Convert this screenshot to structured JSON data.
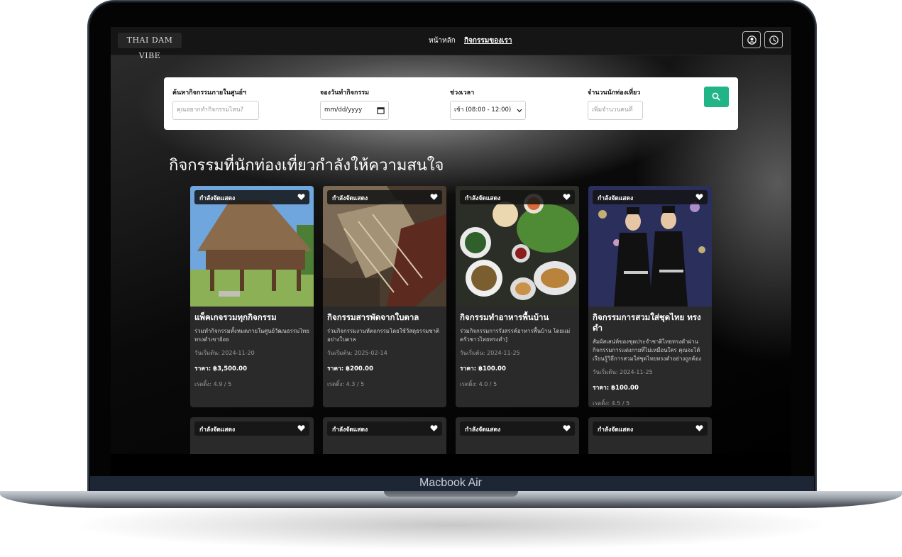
{
  "device": {
    "brand": "Macbook Air"
  },
  "nav": {
    "logo": "THAI DAM VIBE",
    "links": [
      "หน้าหลัก",
      "กิจกรรมของเรา"
    ],
    "active_link": "กิจกรรมของเรา",
    "icons": [
      "user-circle-icon",
      "clock-icon"
    ]
  },
  "search": {
    "activity_label": "ค้นหากิจกรรมภายในศูนย์ฯ",
    "activity_placeholder": "คุณอยากทำกิจกรรมไหน?",
    "date_label": "จองวันทำกิจกรรม",
    "date_value": "mm/dd/yyyy",
    "time_label": "ช่วงเวลา",
    "time_value": "เช้า (08:00 - 12:00)",
    "visitors_label": "จำนวนนักท่องเที่ยว",
    "visitors_placeholder": "เพิ่มจำนวนคนที่",
    "button_icon": "search-icon",
    "button_color": "#20b486"
  },
  "section": {
    "title": "กิจกรรมที่นักท่องเที่ยวกำลังให้ความสนใจ"
  },
  "cards": [
    {
      "badge": "กำลังจัดแสดง",
      "title": "แพ็คเกจรวมทุกกิจกรรม",
      "desc": "ร่วมทำกิจกรรมทั้งหมดภายในศูนย์วัฒนธรรมไทยทรงดำเขาย้อย",
      "date": "วันเริ่มต้น: 2024-11-20",
      "price": "ราคา: ฿3,500.00",
      "rating": "เรตติ้ง: 4.9 / 5"
    },
    {
      "badge": "กำลังจัดแสดง",
      "title": "กิจกรรมสารพัดจากใบตาล",
      "desc": "ร่วมกิจกรรมงานหัตถกรรมโดยใช้วัสดุธรรมชาติอย่างใบตาล",
      "date": "วันเริ่มต้น: 2025-02-14",
      "price": "ราคา: ฿200.00",
      "rating": "เรตติ้ง: 4.3 / 5"
    },
    {
      "badge": "กำลังจัดแสดง",
      "title": "กิจกรรมทำอาหารพื้นบ้าน",
      "desc": "ร่วมกิจกรรมการรังสรรค์อาหารพื้นบ้าน โดยแม่ครัวชาวไทยทรงดำ]",
      "date": "วันเริ่มต้น: 2024-11-25",
      "price": "ราคา: ฿100.00",
      "rating": "เรตติ้ง: 4.0 / 5"
    },
    {
      "badge": "กำลังจัดแสดง",
      "title": "กิจกรรมการสวมใส่ชุดไทย ทรงดำ",
      "desc": "สัมผัสเสน่ห์ของชุดประจำชาติไทยทรงดำผ่านกิจกรรมการแต่งกายที่ไม่เหมือนใคร คุณจะได้เรียนรู้วิธีการสวมใส่ชุดไทยทรงดำอย่างถูกต้อง",
      "date": "วันเริ่มต้น: 2024-11-25",
      "price": "ราคา: ฿100.00",
      "rating": "เรตติ้ง: 4.5 / 5"
    }
  ],
  "cards_row2": [
    {
      "badge": "กำลังจัดแสดง"
    },
    {
      "badge": "กำลังจัดแสดง"
    },
    {
      "badge": "กำลังจัดแสดง"
    },
    {
      "badge": "กำลังจัดแสดง"
    }
  ]
}
